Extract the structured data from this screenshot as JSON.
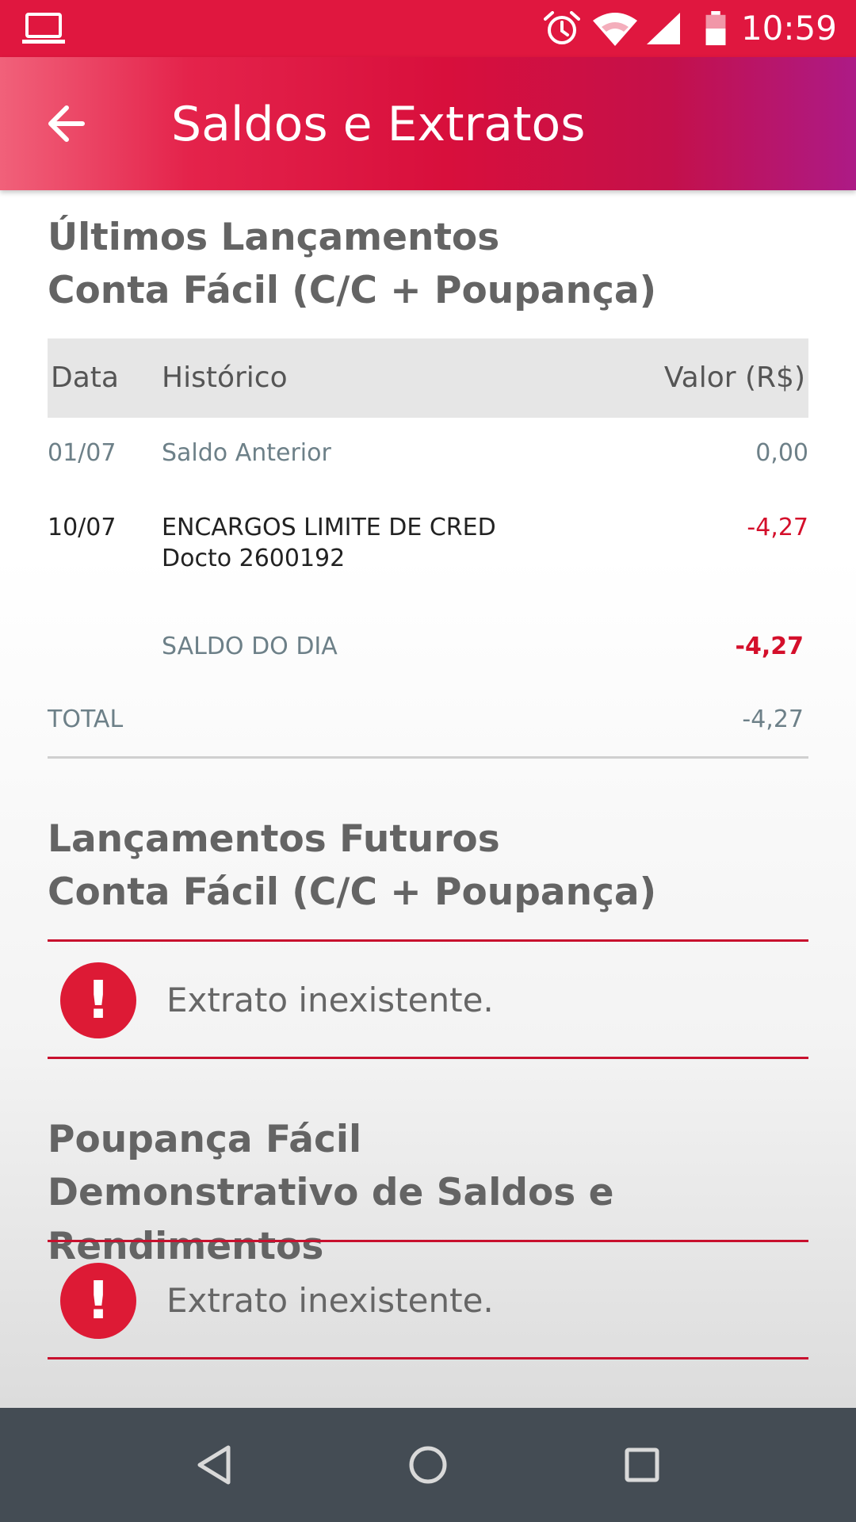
{
  "status_bar": {
    "time": "10:59",
    "icons": [
      "laptop-icon",
      "alarm-icon",
      "wifi-icon",
      "cell-signal-icon",
      "battery-icon"
    ]
  },
  "app_bar": {
    "title": "Saldos e Extratos",
    "back_icon": "arrow-left-icon"
  },
  "sections": {
    "ultimos": {
      "title_line1": "Últimos Lançamentos",
      "title_line2": "Conta Fácil (C/C + Poupança)",
      "columns": {
        "data": "Data",
        "historico": "Histórico",
        "valor": "Valor (R$)"
      },
      "rows": [
        {
          "data": "01/07",
          "historico": "Saldo Anterior",
          "valor": "0,00"
        },
        {
          "data": "10/07",
          "historico_line1": "ENCARGOS LIMITE DE CRED",
          "historico_line2": "Docto 2600192",
          "valor": "-4,27"
        }
      ],
      "saldo_do_dia": {
        "label": "SALDO DO DIA",
        "valor": "-4,27"
      },
      "total": {
        "label": "TOTAL",
        "valor": "-4,27"
      }
    },
    "futuros": {
      "title_line1": "Lançamentos Futuros",
      "title_line2": "Conta Fácil (C/C + Poupança)",
      "error_icon": "!",
      "error_message": "Extrato inexistente."
    },
    "poupanca": {
      "title_line1": "Poupança Fácil",
      "title_line2": "Demonstrativo de Saldos e Rendimentos",
      "error_icon": "!",
      "error_message": "Extrato inexistente."
    }
  },
  "colors": {
    "status_bar": "#e0173f",
    "accent_red": "#d40f2b",
    "divider_red": "#c8102e",
    "nav_bar": "#444c54"
  },
  "nav_bar": {
    "icons": [
      "nav-back-icon",
      "nav-home-icon",
      "nav-recents-icon"
    ]
  }
}
